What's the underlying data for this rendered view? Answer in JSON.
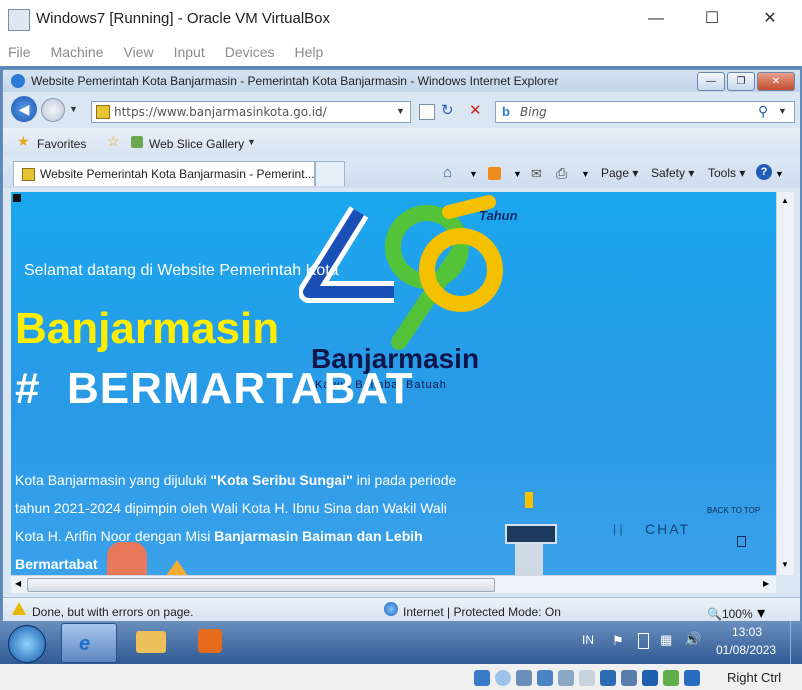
{
  "vbox": {
    "title": "Windows7 [Running] - Oracle VM VirtualBox",
    "menu": [
      "File",
      "Machine",
      "View",
      "Input",
      "Devices",
      "Help"
    ],
    "status_host_key": "Right Ctrl"
  },
  "ie": {
    "title": "Website Pemerintah Kota Banjarmasin - Pemerintah Kota Banjarmasin - Windows Internet Explorer",
    "url": "https://www.banjarmasinkota.go.id/",
    "search_placeholder": "Bing",
    "favorites": "Favorites",
    "web_slice": "Web Slice Gallery",
    "tab_title": "Website Pemerintah Kota Banjarmasin - Pemerint...",
    "commands": {
      "page": "Page",
      "safety": "Safety",
      "tools": "Tools"
    },
    "status": {
      "text": "Done, but with errors on page.",
      "zone": "Internet | Protected Mode: On",
      "zoom": "100%"
    }
  },
  "page": {
    "logo_number": "496",
    "logo_tahun": "Tahun",
    "logo_city": "Banjarmasin",
    "logo_tagline": "Kayuh Baimbai Batuah",
    "welcome": "Selamat datang di Website Pemerintah Kota",
    "city": "Banjarmasin",
    "hashtag": "#",
    "hashtag_text": "BERMARTABAT",
    "intro_a": "Kota Banjarmasin yang dijuluki ",
    "intro_bold1": "\"Kota Seribu Sungai\"",
    "intro_b": " ini pada periode tahun 2021-2024 dipimpin oleh Wali Kota H. Ibnu Sina dan Wakil Wali Kota H. Arifin Noor dengan Misi ",
    "intro_bold2": "Banjarmasin Baiman dan Lebih Bermartabat",
    "back_to_top": "BACK TO TOP",
    "chat": "CHAT"
  },
  "taskbar": {
    "lang": "IN",
    "time": "13:03",
    "date": "01/08/2023"
  },
  "colors": {
    "page_bg": "#1aa7ef",
    "city_yellow": "#ffee00",
    "logo_blue": "#1a4fb8",
    "logo_green": "#55c33a",
    "logo_yellow": "#f5c000"
  }
}
